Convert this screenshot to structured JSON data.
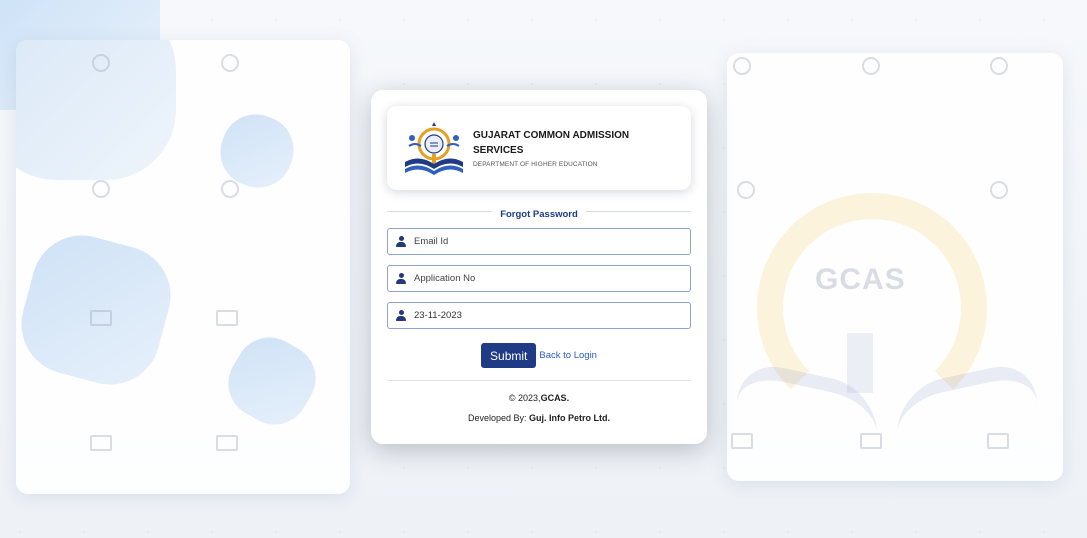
{
  "brand": {
    "title": "GUJARAT COMMON ADMISSION SERVICES",
    "subtitle": "DEPARTMENT OF HIGHER EDUCATION",
    "logo_icon": "gcas-logo-icon"
  },
  "form": {
    "heading": "Forgot Password",
    "fields": [
      {
        "icon": "user-icon",
        "placeholder": "Email Id",
        "value": ""
      },
      {
        "icon": "user-icon",
        "placeholder": "Application No",
        "value": ""
      },
      {
        "icon": "user-icon",
        "placeholder": "",
        "value": "23-11-2023"
      }
    ],
    "submit_label": "Submit",
    "back_link": "Back to Login"
  },
  "footer": {
    "copyright_prefix": "© 2023,",
    "copyright_org": "GCAS.",
    "developed_prefix": "Developed By: ",
    "developed_org": "Guj. Info Petro Ltd."
  },
  "watermark": {
    "text": "GCAS"
  },
  "colors": {
    "primary": "#1f3b86",
    "link": "#2a58c9",
    "field_border": "#8fa3cc",
    "accent_gold": "#e8a020"
  }
}
